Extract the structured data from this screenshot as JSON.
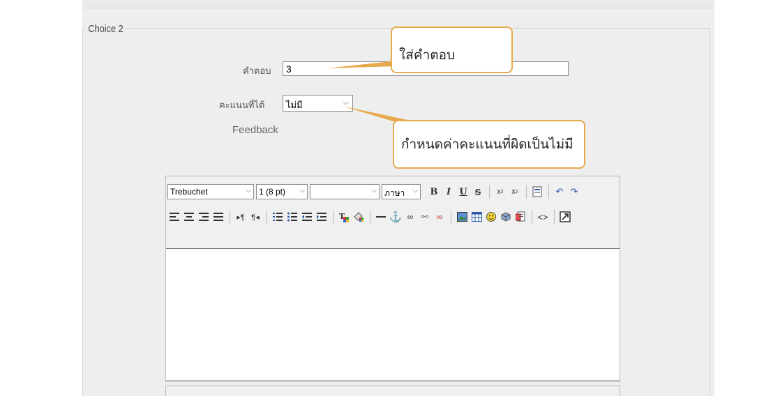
{
  "fieldset": {
    "legend": "Choice 2"
  },
  "form": {
    "answer_label": "คำตอบ",
    "answer_value": "3",
    "grade_label": "คะแนนที่ได้",
    "grade_value": "ไม่มี",
    "feedback_label": "Feedback"
  },
  "callouts": {
    "answer_note": "ใส่คำตอบ",
    "grade_note": "กำหนดค่าคะแนนที่ผิดเป็นไม่มี",
    "border_color": "#e6a94c"
  },
  "editor": {
    "font_family": "Trebuchet",
    "font_size": "1 (8 pt)",
    "style_value": "",
    "language": "ภาษา",
    "icons_row1": [
      "bold-icon",
      "italic-icon",
      "underline-icon",
      "strikethrough-icon",
      "subscript-icon",
      "superscript-icon",
      "paste-word-icon",
      "undo-icon",
      "redo-icon"
    ],
    "icons_row2": [
      "align-left-icon",
      "align-center-icon",
      "align-right-icon",
      "justify-icon",
      "ltr-icon",
      "rtl-icon",
      "ordered-list-icon",
      "unordered-list-icon",
      "outdent-icon",
      "indent-icon",
      "text-color-icon",
      "background-color-icon",
      "horizontal-rule-icon",
      "anchor-icon",
      "link-icon",
      "unlink-icon",
      "nolink-icon",
      "image-icon",
      "table-icon",
      "smiley-icon",
      "special-char-icon",
      "search-replace-icon",
      "html-source-icon",
      "fullscreen-icon"
    ]
  }
}
